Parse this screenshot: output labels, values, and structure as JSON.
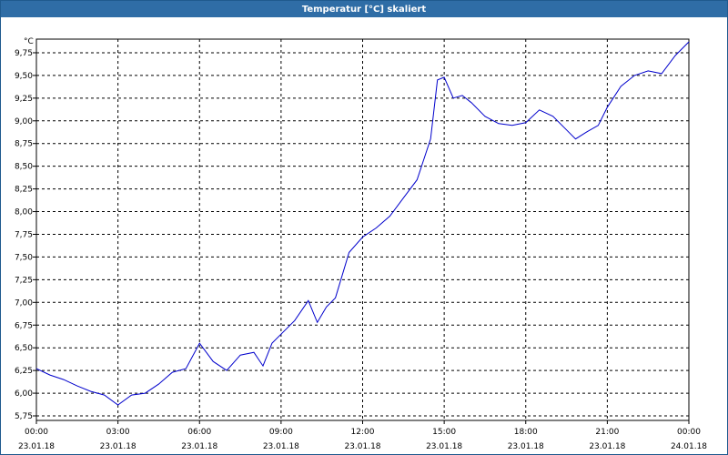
{
  "window": {
    "title": "Temperatur [°C] skaliert"
  },
  "chart_data": {
    "type": "line",
    "title": "Temperatur [°C] skaliert",
    "xlabel": "",
    "ylabel": "°C",
    "ylim": [
      5.7,
      9.9
    ],
    "xlim": [
      "2018-01-23 00:00",
      "2018-01-24 00:00"
    ],
    "grid": true,
    "y_ticks": [
      "5,75",
      "6,00",
      "6,25",
      "6,50",
      "6,75",
      "7,00",
      "7,25",
      "7,50",
      "7,75",
      "8,00",
      "8,25",
      "8,50",
      "8,75",
      "9,00",
      "9,25",
      "9,50",
      "9,75"
    ],
    "x_ticks": [
      {
        "time": "00:00",
        "date": "23.01.18"
      },
      {
        "time": "03:00",
        "date": "23.01.18"
      },
      {
        "time": "06:00",
        "date": "23.01.18"
      },
      {
        "time": "09:00",
        "date": "23.01.18"
      },
      {
        "time": "12:00",
        "date": "23.01.18"
      },
      {
        "time": "15:00",
        "date": "23.01.18"
      },
      {
        "time": "18:00",
        "date": "23.01.18"
      },
      {
        "time": "21:00",
        "date": "23.01.18"
      },
      {
        "time": "00:00",
        "date": "24.01.18"
      }
    ],
    "series": [
      {
        "color": "#0000cc",
        "x": [
          "00:00",
          "00:30",
          "01:00",
          "01:30",
          "02:00",
          "02:30",
          "03:00",
          "03:30",
          "04:00",
          "04:30",
          "05:00",
          "05:30",
          "06:00",
          "06:30",
          "07:00",
          "07:30",
          "08:00",
          "08:20",
          "08:40",
          "09:00",
          "09:30",
          "10:00",
          "10:20",
          "10:40",
          "11:00",
          "11:30",
          "12:00",
          "12:30",
          "13:00",
          "13:30",
          "14:00",
          "14:30",
          "14:45",
          "15:00",
          "15:20",
          "15:40",
          "16:00",
          "16:30",
          "17:00",
          "17:30",
          "18:00",
          "18:30",
          "19:00",
          "19:30",
          "19:50",
          "20:15",
          "20:40",
          "21:00",
          "21:30",
          "22:00",
          "22:30",
          "23:00",
          "23:30",
          "24:00"
        ],
        "y": [
          6.27,
          6.2,
          6.15,
          6.08,
          6.02,
          5.98,
          5.87,
          5.98,
          6.0,
          6.1,
          6.23,
          6.27,
          6.55,
          6.35,
          6.25,
          6.42,
          6.45,
          6.3,
          6.55,
          6.65,
          6.8,
          7.02,
          6.78,
          6.95,
          7.05,
          7.55,
          7.72,
          7.82,
          7.95,
          8.15,
          8.35,
          8.8,
          9.45,
          9.48,
          9.25,
          9.28,
          9.2,
          9.05,
          8.97,
          8.95,
          8.98,
          9.12,
          9.05,
          8.9,
          8.8,
          8.88,
          8.95,
          9.15,
          9.38,
          9.5,
          9.55,
          9.52,
          9.72,
          9.87
        ]
      }
    ]
  }
}
